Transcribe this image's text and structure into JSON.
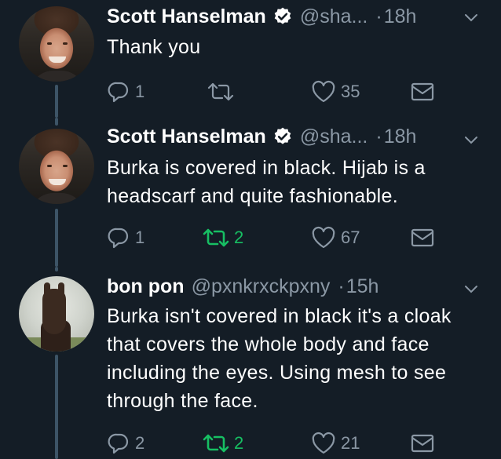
{
  "tweets": [
    {
      "name": "Scott Hanselman",
      "handle": "@sha...",
      "separator": "·",
      "time": "18h",
      "text": "Thank you",
      "reply_count": "1",
      "retweet_count": "",
      "like_count": "35",
      "retweeted": false
    },
    {
      "name": "Scott Hanselman",
      "handle": "@sha...",
      "separator": "·",
      "time": "18h",
      "text": "Burka is covered in black. Hijab is a headscarf and quite fashionable.",
      "reply_count": "1",
      "retweet_count": "2",
      "like_count": "67",
      "retweeted": true
    },
    {
      "name": "bon pon",
      "handle": "@pxnkrxckpxny",
      "separator": "·",
      "time": "15h",
      "text": "Burka isn't covered in black it's a cloak that covers the whole body and face including the eyes. Using mesh to see through the face.",
      "reply_count": "2",
      "retweet_count": "2",
      "like_count": "21",
      "retweeted": true
    }
  ],
  "colors": {
    "background": "#141d26",
    "muted": "#8b98a5",
    "verified": "#ffffff",
    "retweet_active": "#17bf63",
    "thread_line": "#3d5466"
  },
  "icons": [
    "reply-icon",
    "retweet-icon",
    "like-icon",
    "direct-message-icon",
    "verified-badge-icon",
    "chevron-down-icon"
  ]
}
